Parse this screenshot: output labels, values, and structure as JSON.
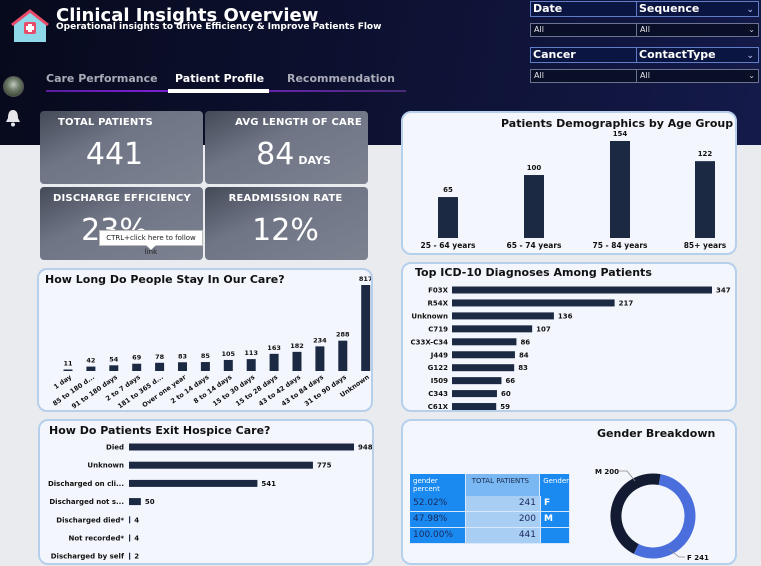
{
  "header": {
    "title": "Clinical Insights Overview",
    "subtitle": "Operational insights to drive Efficiency & Improve Patients Flow"
  },
  "tabs": [
    {
      "label": "Care Performance"
    },
    {
      "label": "Patient Profile"
    },
    {
      "label": "Recommendation"
    }
  ],
  "filters": [
    {
      "label": "Date",
      "value": "All"
    },
    {
      "label": "Sequence",
      "value": "All"
    },
    {
      "label": "Cancer",
      "value": "All"
    },
    {
      "label": "ContactType",
      "value": "All"
    }
  ],
  "kpis": {
    "total_patients": {
      "label": "TOTAL PATIENTS",
      "value": "441"
    },
    "avg_length": {
      "label": "AVG LENGTH OF CARE",
      "value": "84",
      "unit": "DAYS"
    },
    "discharge_eff": {
      "label": "DISCHARGE EFFICIENCY",
      "value": "23%"
    },
    "readmission": {
      "label": "READMISSION RATE",
      "value": "12%"
    }
  },
  "tooltip": "CTRL+click here to follow link",
  "colors": {
    "bar": "#1b2943",
    "donut_f": "#4a6fdc",
    "donut_m": "#131b33",
    "table_blue": "#1a8af0"
  },
  "chart_data": [
    {
      "id": "age",
      "type": "bar",
      "title": "Patients Demographics by Age Group",
      "categories": [
        "25 - 64 years",
        "65 - 74 years",
        "75 - 84 years",
        "85+ years"
      ],
      "values": [
        65,
        100,
        154,
        122
      ]
    },
    {
      "id": "stay",
      "type": "bar",
      "title": "How Long Do People Stay In Our Care?",
      "categories": [
        "1 day",
        "85 to 180 d...",
        "91 to 180 days",
        "2 to 7 days",
        "181 to 365 d...",
        "Over one year",
        "2 to 14 days",
        "8 to 14 days",
        "15 to 30 days",
        "15 to 28 days",
        "43 to 42 days",
        "43 to 84 days",
        "31 to 90 days",
        "Unknown"
      ],
      "values": [
        11,
        42,
        54,
        69,
        78,
        83,
        85,
        105,
        113,
        163,
        182,
        234,
        288,
        817
      ]
    },
    {
      "id": "icd",
      "type": "bar",
      "orientation": "horizontal",
      "title": "Top ICD-10 Diagnoses Among Patients",
      "categories": [
        "F03X",
        "R54X",
        "Unknown",
        "C719",
        "C33X-C34",
        "J449",
        "G122",
        "I509",
        "C343",
        "C61X"
      ],
      "values": [
        347,
        217,
        136,
        107,
        86,
        84,
        83,
        66,
        60,
        59
      ]
    },
    {
      "id": "exit",
      "type": "bar",
      "orientation": "horizontal",
      "title": "How Do Patients Exit Hospice Care?",
      "categories": [
        "Died",
        "Unknown",
        "Discharged on cli...",
        "Discharged not s...",
        "Discharged died*",
        "Not recorded*",
        "Discharged by self"
      ],
      "values": [
        948,
        775,
        541,
        50,
        4,
        4,
        2
      ]
    },
    {
      "id": "gender",
      "type": "pie",
      "title": "Gender Breakdown",
      "categories": [
        "F",
        "M"
      ],
      "values": [
        241,
        200
      ],
      "labels": [
        "F 241",
        "M 200"
      ]
    }
  ],
  "gender_table": {
    "headers": [
      "gender percent",
      "TOTAL PATIENTS",
      "Gender"
    ],
    "rows": [
      [
        "52.02%",
        "241",
        "F"
      ],
      [
        "47.98%",
        "200",
        "M"
      ],
      [
        "100.00%",
        "441",
        ""
      ]
    ]
  }
}
